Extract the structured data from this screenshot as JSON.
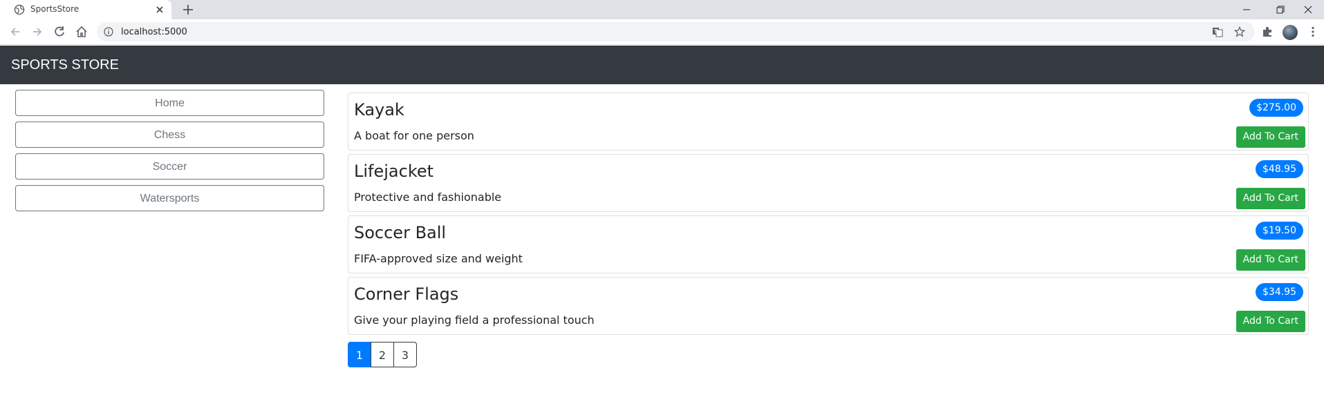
{
  "browser": {
    "tab_title": "SportsStore",
    "url": "localhost:5000",
    "icons": [
      "globe-icon",
      "close-icon",
      "plus-icon",
      "back-icon",
      "forward-icon",
      "reload-icon",
      "home-icon",
      "info-icon",
      "translate-icon",
      "star-icon",
      "extensions-icon",
      "menu-icon",
      "minimize-icon",
      "restore-icon"
    ]
  },
  "header": {
    "brand": "SPORTS STORE"
  },
  "sidebar": {
    "categories": [
      {
        "label": "Home"
      },
      {
        "label": "Chess"
      },
      {
        "label": "Soccer"
      },
      {
        "label": "Watersports"
      }
    ]
  },
  "products": [
    {
      "name": "Kayak",
      "price": "$275.00",
      "description": "A boat for one person",
      "button": "Add To Cart"
    },
    {
      "name": "Lifejacket",
      "price": "$48.95",
      "description": "Protective and fashionable",
      "button": "Add To Cart"
    },
    {
      "name": "Soccer Ball",
      "price": "$19.50",
      "description": "FIFA-approved size and weight",
      "button": "Add To Cart"
    },
    {
      "name": "Corner Flags",
      "price": "$34.95",
      "description": "Give your playing field a professional touch",
      "button": "Add To Cart"
    }
  ],
  "pagination": {
    "pages": [
      "1",
      "2",
      "3"
    ],
    "current": "1"
  },
  "colors": {
    "navbar": "#343a40",
    "price_badge": "#007bff",
    "add_to_cart": "#28a745",
    "active_page": "#007bff"
  }
}
